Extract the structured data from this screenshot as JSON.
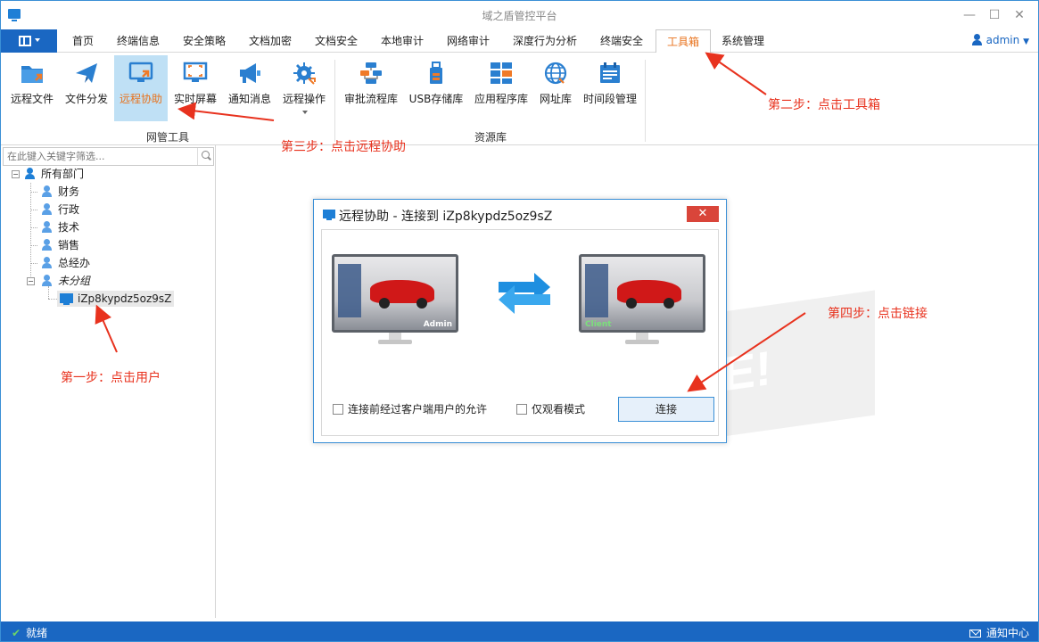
{
  "window": {
    "title": "域之盾管控平台"
  },
  "menu": {
    "tabs": [
      {
        "label": "首页"
      },
      {
        "label": "终端信息"
      },
      {
        "label": "安全策略"
      },
      {
        "label": "文档加密"
      },
      {
        "label": "文档安全"
      },
      {
        "label": "本地审计"
      },
      {
        "label": "网络审计"
      },
      {
        "label": "深度行为分析"
      },
      {
        "label": "终端安全"
      },
      {
        "label": "工具箱"
      },
      {
        "label": "系统管理"
      }
    ],
    "active_tab": "工具箱",
    "user": "admin"
  },
  "ribbon": {
    "tools": [
      {
        "label": "远程文件",
        "icon": "folder-arrow-icon"
      },
      {
        "label": "文件分发",
        "icon": "paper-plane-icon"
      },
      {
        "label": "远程协助",
        "icon": "remote-monitor-icon"
      },
      {
        "label": "实时屏幕",
        "icon": "screen-capture-icon"
      },
      {
        "label": "通知消息",
        "icon": "megaphone-icon"
      },
      {
        "label": "远程操作",
        "icon": "gear-icon"
      }
    ],
    "tools_group": "网管工具",
    "resources": [
      {
        "label": "审批流程库",
        "icon": "workflow-icon"
      },
      {
        "label": "USB存储库",
        "icon": "usb-icon"
      },
      {
        "label": "应用程序库",
        "icon": "app-grid-icon"
      },
      {
        "label": "网址库",
        "icon": "globe-icon"
      },
      {
        "label": "时间段管理",
        "icon": "calendar-icon"
      }
    ],
    "resources_group": "资源库",
    "selected_tool": "远程协助"
  },
  "tree": {
    "search_placeholder": "在此键入关键字筛选...",
    "root": "所有部门",
    "departments": [
      {
        "label": "财务"
      },
      {
        "label": "行政"
      },
      {
        "label": "技术"
      },
      {
        "label": "销售"
      },
      {
        "label": "总经办"
      },
      {
        "label": "未分组"
      }
    ],
    "device": "iZp8kypdz5oz9sZ"
  },
  "dialog": {
    "title": "远程协助 - 连接到 iZp8kypdz5oz9sZ",
    "close": "✕",
    "admin_tag": "Admin",
    "client_tag": "Client",
    "option_permission": "连接前经过客户端用户的允许",
    "option_view_only": "仅观看模式",
    "connect": "连接"
  },
  "annotations": {
    "step1": "第一步：点击用户",
    "step2": "第二步：点击工具箱",
    "step3": "第三步：点击远程协助",
    "step4": "第四步：点击链接"
  },
  "status": {
    "ready": "就绪",
    "notifications": "通知中心"
  },
  "colors": {
    "accent": "#1a67c2",
    "active_tab": "#e8721c",
    "annotation": "#e8321e",
    "selected_bg": "#bfe0f5"
  }
}
